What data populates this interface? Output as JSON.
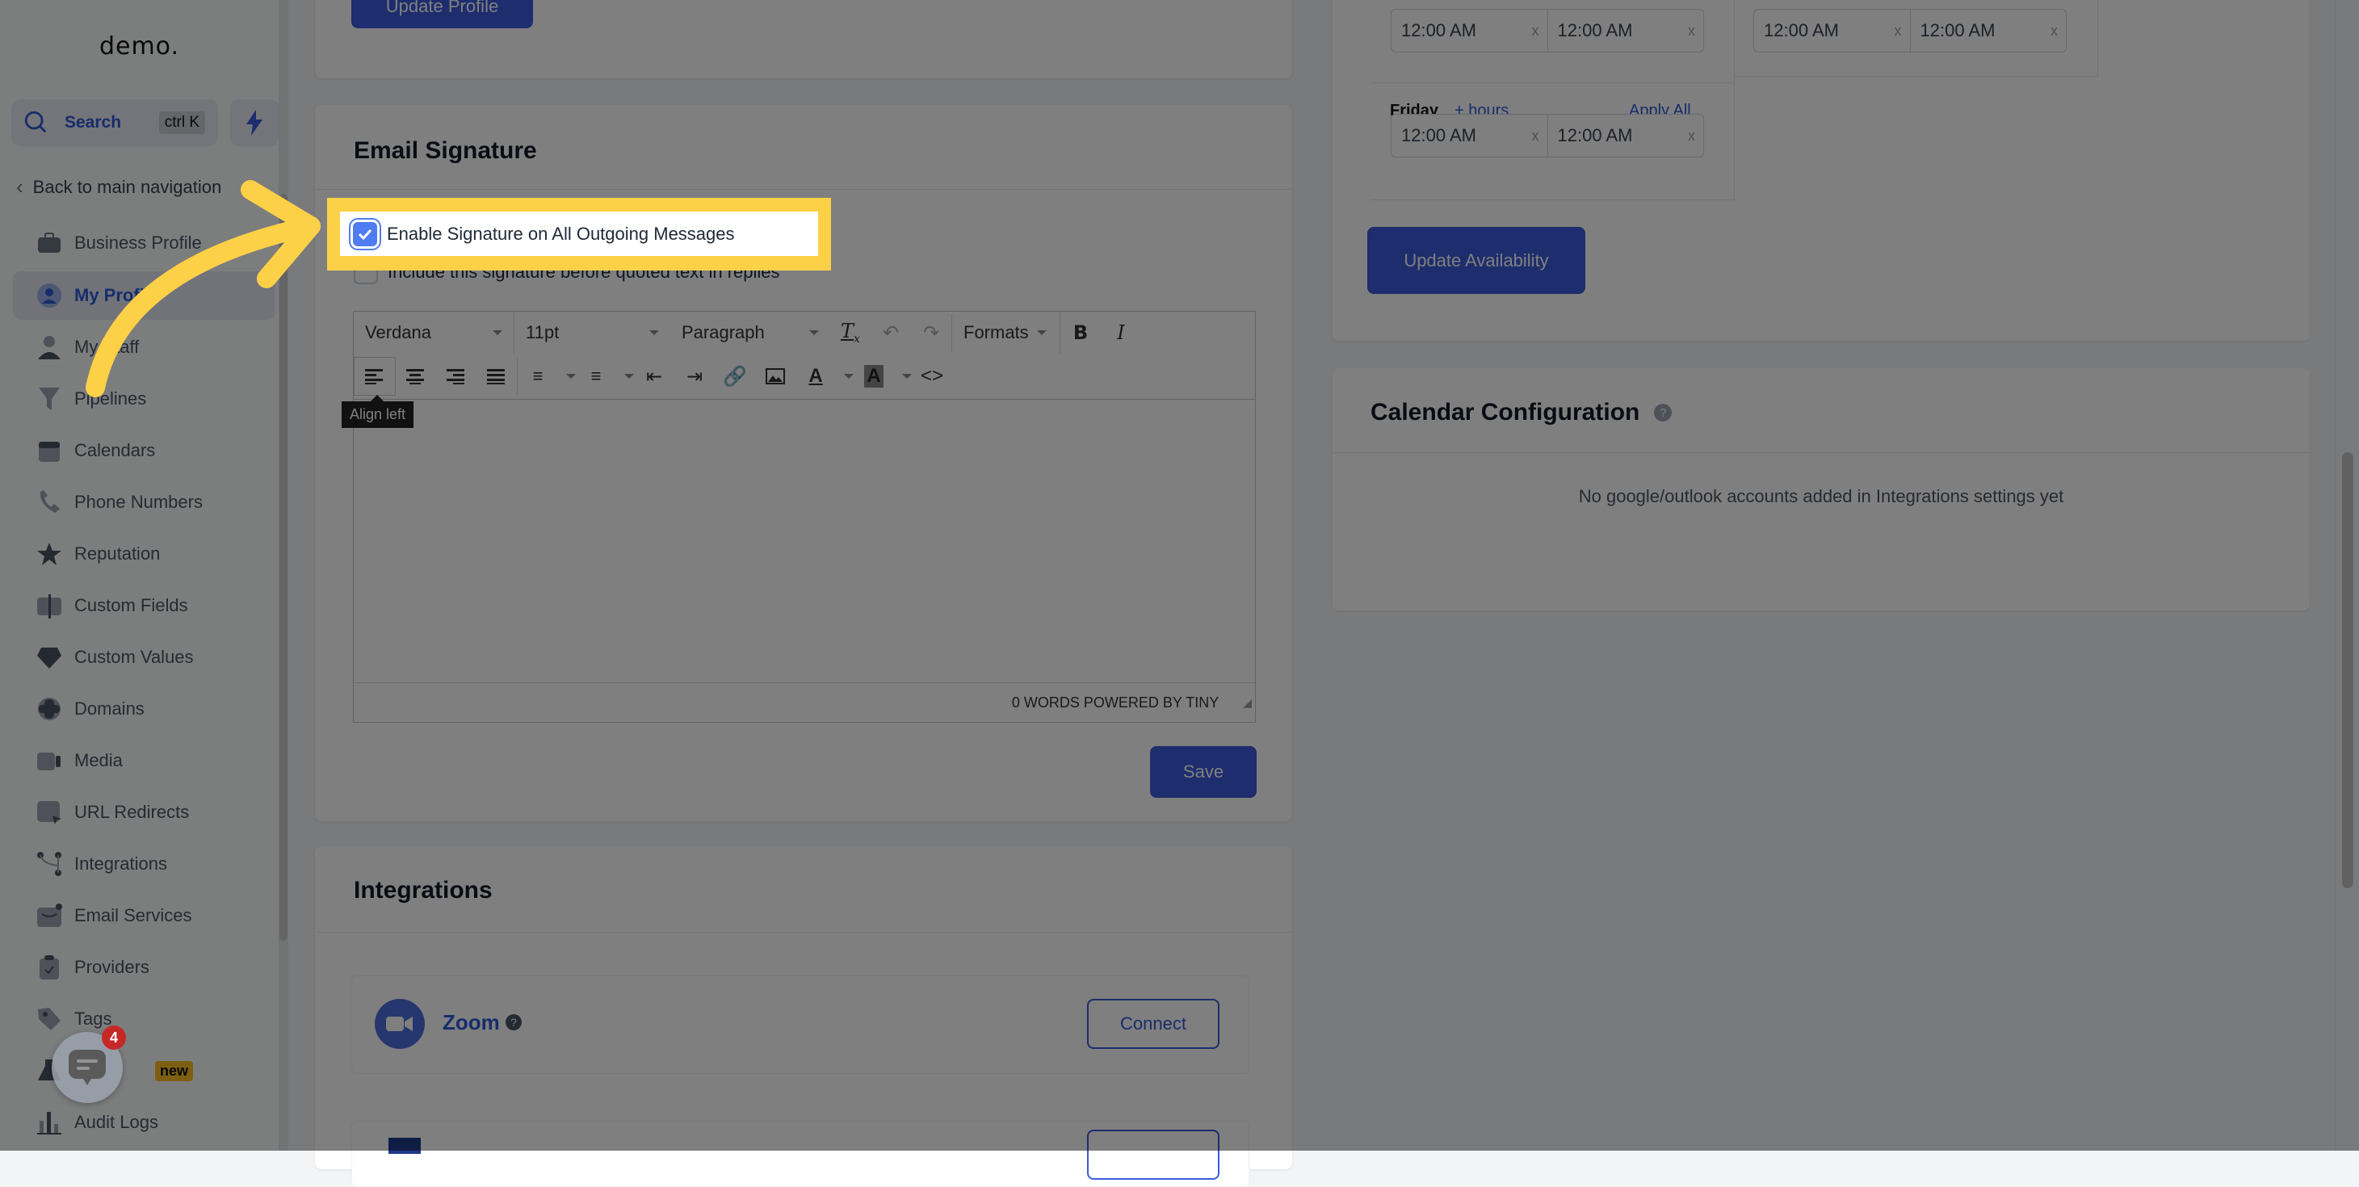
{
  "sidebar": {
    "logo": "demo.",
    "search": {
      "label": "Search",
      "shortcut": "ctrl K"
    },
    "back_label": "Back to main navigation",
    "items": [
      {
        "label": "Business Profile",
        "icon": "briefcase-icon",
        "active": false
      },
      {
        "label": "My Profile",
        "icon": "user-circle-icon",
        "active": true
      },
      {
        "label": "My Staff",
        "icon": "user-icon",
        "active": false
      },
      {
        "label": "Pipelines",
        "icon": "funnel-icon",
        "active": false
      },
      {
        "label": "Calendars",
        "icon": "calendar-icon",
        "active": false
      },
      {
        "label": "Phone Numbers",
        "icon": "phone-icon",
        "active": false
      },
      {
        "label": "Reputation",
        "icon": "star-icon",
        "active": false
      },
      {
        "label": "Custom Fields",
        "icon": "text-field-icon",
        "active": false
      },
      {
        "label": "Custom Values",
        "icon": "gem-icon",
        "active": false
      },
      {
        "label": "Domains",
        "icon": "globe-icon",
        "active": false
      },
      {
        "label": "Media",
        "icon": "video-icon",
        "active": false
      },
      {
        "label": "URL Redirects",
        "icon": "redirect-icon",
        "active": false
      },
      {
        "label": "Integrations",
        "icon": "branch-icon",
        "active": false
      },
      {
        "label": "Email Services",
        "icon": "mail-icon",
        "active": false
      },
      {
        "label": "Providers",
        "icon": "clipboard-check-icon",
        "active": false
      },
      {
        "label": "Tags",
        "icon": "tag-icon",
        "active": false
      },
      {
        "label": "",
        "icon": "flask-icon",
        "badge": "new",
        "active": false
      },
      {
        "label": "Audit Logs",
        "icon": "bar-chart-icon",
        "active": false
      }
    ]
  },
  "chat_widget": {
    "unread_count": "4"
  },
  "profile_card": {
    "update_label": "Update Profile"
  },
  "email_signature": {
    "title": "Email Signature",
    "enable_label": "Enable Signature on All Outgoing Messages",
    "enable_checked": true,
    "include_label": "Include this signature before quoted text in replies",
    "include_checked": false,
    "editor": {
      "font": "Verdana",
      "size": "11pt",
      "block": "Paragraph",
      "formats": "Formats",
      "tooltip": "Align left",
      "status": "0 WORDS POWERED BY TINY"
    },
    "save_label": "Save"
  },
  "integrations": {
    "title": "Integrations",
    "items": [
      {
        "name": "Zoom",
        "action": "Connect"
      }
    ]
  },
  "availability": {
    "days": [
      {
        "name": "",
        "apply": "",
        "from": "12:00 AM",
        "to": "12:00 AM"
      },
      {
        "name": "",
        "apply": "",
        "from": "12:00 AM",
        "to": "12:00 AM"
      },
      {
        "name": "Friday",
        "add_hours": "+ hours",
        "apply": "Apply All",
        "from": "12:00 AM",
        "to": "12:00 AM"
      }
    ],
    "update_label": "Update Availability"
  },
  "calendar_config": {
    "title": "Calendar Configuration",
    "empty_text": "No google/outlook accounts added in Integrations settings yet"
  },
  "highlight_color": "#fdd147",
  "accent_color": "#3b5bdb"
}
